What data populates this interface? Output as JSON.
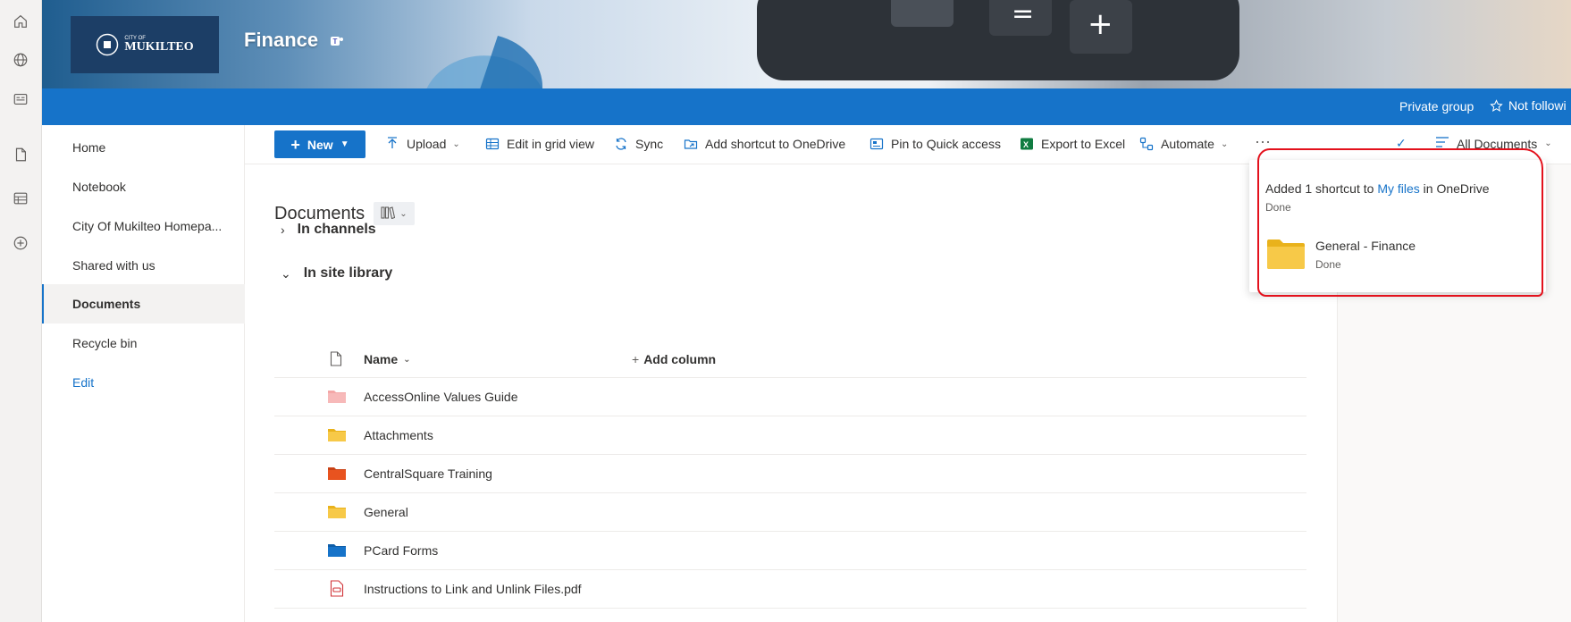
{
  "colors": {
    "accent": "#1673c9",
    "suite_bar": "#1673c9",
    "logo_bg": "#1c3e66",
    "annotation": "#e3111c"
  },
  "app_rail": {
    "icons": [
      "home-icon",
      "globe-icon",
      "news-icon",
      "document-icon",
      "list-icon",
      "add-circle-icon"
    ]
  },
  "header": {
    "logo_top": "CITY OF",
    "logo_text": "MUKILTEO",
    "site_title": "Finance",
    "teams_icon": "teams-icon",
    "privacy": "Private group",
    "follow": "Not followi"
  },
  "left_nav": {
    "items": [
      {
        "label": "Home"
      },
      {
        "label": "Notebook"
      },
      {
        "label": "City Of Mukilteo Homepa..."
      },
      {
        "label": "Shared with us"
      },
      {
        "label": "Documents",
        "active": true
      },
      {
        "label": "Recycle bin"
      }
    ],
    "edit": "Edit"
  },
  "toolbar": {
    "new": "New",
    "upload": "Upload",
    "grid": "Edit in grid view",
    "sync": "Sync",
    "shortcut": "Add shortcut to OneDrive",
    "pin": "Pin to Quick access",
    "export": "Export to Excel",
    "automate": "Automate",
    "more": "···",
    "view": "All Documents"
  },
  "library": {
    "title": "Documents",
    "section_channels": "In channels",
    "section_site": "In site library",
    "col_name": "Name",
    "col_add": "Add column",
    "rows": [
      {
        "name": "AccessOnline Values Guide",
        "icon": "folder-icon",
        "color": "#f4a7a7"
      },
      {
        "name": "Attachments",
        "icon": "folder-icon",
        "color": "#f7c948"
      },
      {
        "name": "CentralSquare Training",
        "icon": "folder-icon",
        "color": "#e8531f"
      },
      {
        "name": "General",
        "icon": "folder-icon",
        "color": "#f7c948"
      },
      {
        "name": "PCard Forms",
        "icon": "folder-icon",
        "color": "#1673c9"
      },
      {
        "name": "Instructions to Link and Unlink Files.pdf",
        "icon": "pdf-icon",
        "color": "#d13438"
      }
    ]
  },
  "notification": {
    "prefix": "Added 1 shortcut to ",
    "link": "My files",
    "suffix": " in OneDrive",
    "status": "Done",
    "item_name": "General - Finance",
    "item_status": "Done"
  }
}
